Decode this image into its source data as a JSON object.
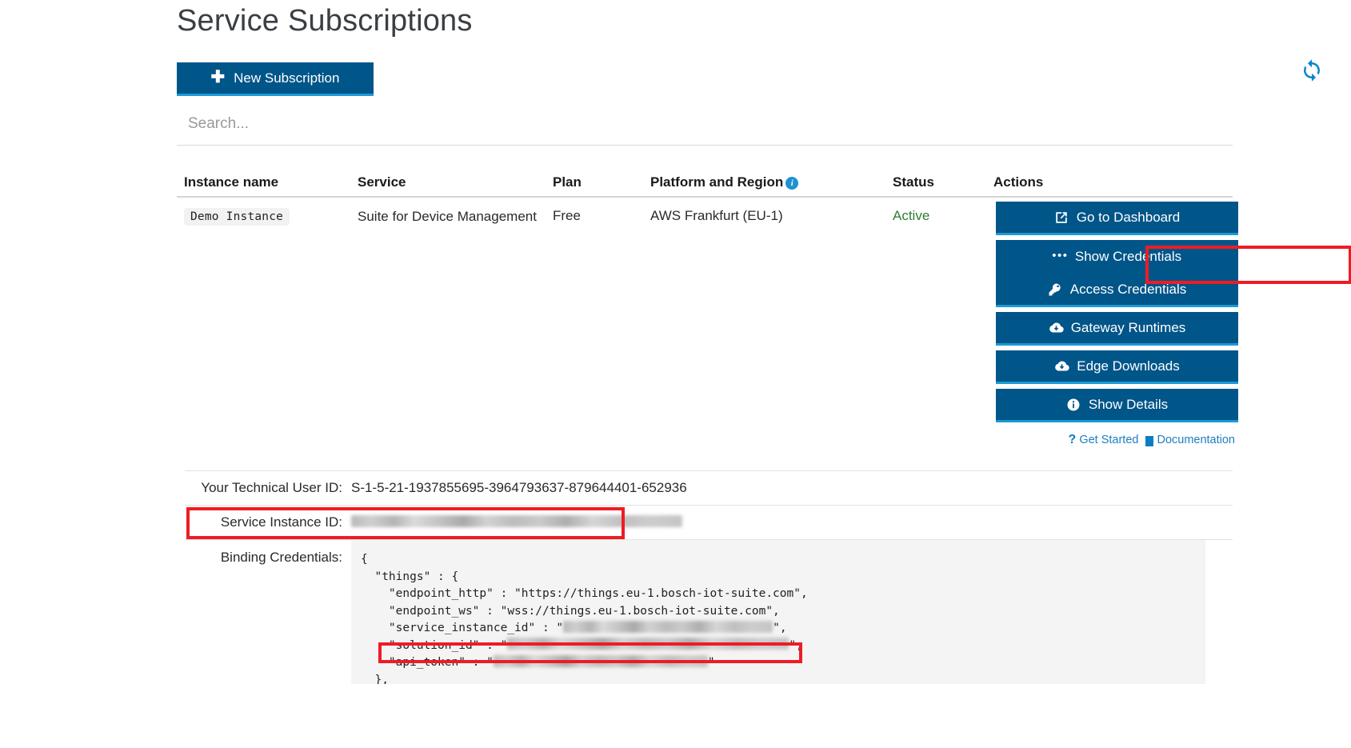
{
  "page": {
    "title": "Service Subscriptions"
  },
  "toolbar": {
    "new_subscription_label": "New Subscription",
    "new_subscription_icon": "plus-icon",
    "refresh_icon": "refresh-icon",
    "accent_color": "#005589",
    "accent_underline_color": "#1b9ad6"
  },
  "search": {
    "placeholder": "Search...",
    "value": ""
  },
  "table": {
    "headers": {
      "instance_name": "Instance name",
      "service": "Service",
      "plan": "Plan",
      "platform_and_region": "Platform and Region",
      "platform_info_icon": "info-icon",
      "status": "Status",
      "actions": "Actions"
    },
    "rows": [
      {
        "instance_name": "Demo Instance",
        "service": "Suite for Device Management",
        "plan": "Free",
        "platform_and_region": "AWS Frankfurt (EU-1)",
        "status": "Active",
        "status_color": "#2e7d32"
      }
    ]
  },
  "actions": {
    "buttons": [
      {
        "label": "Go to Dashboard",
        "icon": "external-link-icon"
      },
      {
        "label": "Show Credentials",
        "icon": "ellipsis-icon"
      },
      {
        "label": "Access Credentials",
        "icon": "key-icon"
      },
      {
        "label": "Gateway Runtimes",
        "icon": "cloud-download-icon"
      },
      {
        "label": "Edge Downloads",
        "icon": "cloud-download-icon"
      },
      {
        "label": "Show Details",
        "icon": "info-circle-icon"
      }
    ],
    "links": [
      {
        "label": "Get Started",
        "icon": "question-mark-icon"
      },
      {
        "label": "Documentation",
        "icon": "book-icon"
      }
    ]
  },
  "details": {
    "technical_user_id_label": "Your Technical User ID:",
    "technical_user_id_value": "S-1-5-21-1937855695-3964793637-879644401-652936",
    "service_instance_id_label": "Service Instance ID:",
    "service_instance_id_value": "",
    "binding_credentials_label": "Binding Credentials:"
  },
  "credentials_json": {
    "line1": "{",
    "line2": "  \"things\" : {",
    "line3": "    \"endpoint_http\" : \"https://things.eu-1.bosch-iot-suite.com\",",
    "line4": "    \"endpoint_ws\" : \"wss://things.eu-1.bosch-iot-suite.com\",",
    "line5_key": "    \"service_instance_id\" : \"",
    "line6_key": "    \"solution_id\" : \"",
    "line7_key": "    \"api_token\" : \"",
    "line8": "  },"
  },
  "annotations": {
    "highlight_color": "#ee1c25",
    "boxes": [
      {
        "target": "show-credentials-button"
      },
      {
        "target": "service-instance-id-row"
      },
      {
        "target": "solution-id-line"
      }
    ]
  }
}
